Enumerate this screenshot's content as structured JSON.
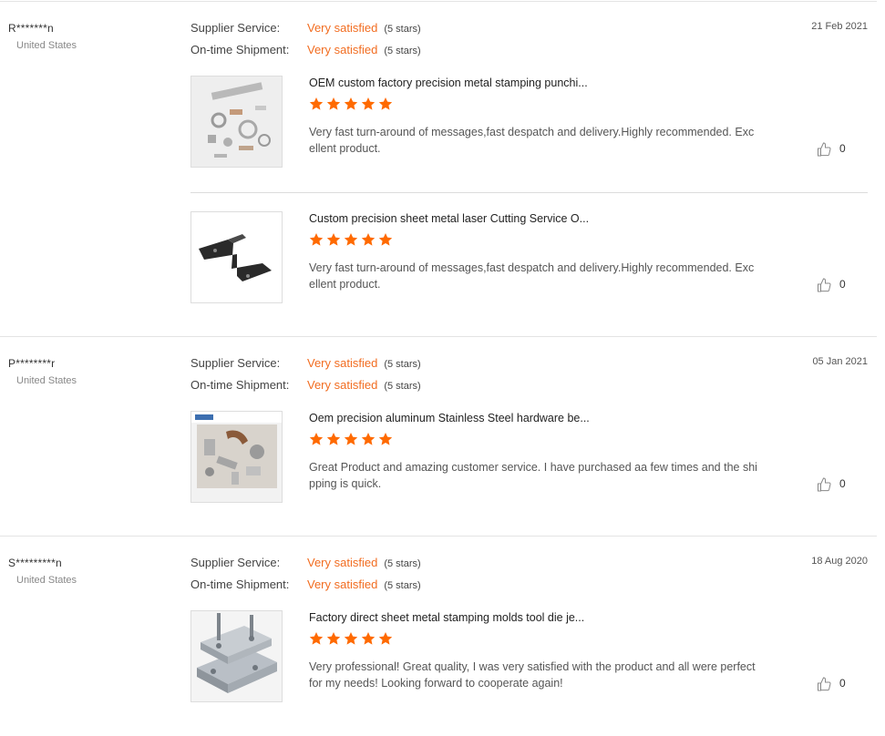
{
  "colors": {
    "accent": "#f26d21",
    "star": "#ff6a00",
    "divider": "#e4e4e4"
  },
  "reviews": [
    {
      "reviewer": "R*******n",
      "country": "United States",
      "date": "21 Feb 2021",
      "ratings": [
        {
          "label": "Supplier Service:",
          "value": "Very satisfied",
          "stars_text": "(5 stars)"
        },
        {
          "label": "On-time Shipment:",
          "value": "Very satisfied",
          "stars_text": "(5 stars)"
        }
      ],
      "products": [
        {
          "title": "OEM custom factory precision metal stamping punchi...",
          "rating": 5,
          "comment": "Very fast turn-around of messages,fast despatch and delivery.Highly recommended. Excellent product.",
          "likes": "0",
          "image_icon": "metal-parts-photo"
        },
        {
          "title": "Custom precision sheet metal laser Cutting Service O...",
          "rating": 5,
          "comment": "Very fast turn-around of messages,fast despatch and delivery.Highly recommended. Excellent product.",
          "likes": "0",
          "image_icon": "bracket-photo"
        }
      ]
    },
    {
      "reviewer": "P********r",
      "country": "United States",
      "date": "05 Jan 2021",
      "ratings": [
        {
          "label": "Supplier Service:",
          "value": "Very satisfied",
          "stars_text": "(5 stars)"
        },
        {
          "label": "On-time Shipment:",
          "value": "Very satisfied",
          "stars_text": "(5 stars)"
        }
      ],
      "products": [
        {
          "title": "Oem precision aluminum Stainless Steel hardware be...",
          "rating": 5,
          "comment": "Great Product and amazing customer service. I have purchased aa few times and the shipping is quick.",
          "likes": "0",
          "image_icon": "hardware-photo"
        }
      ]
    },
    {
      "reviewer": "S*********n",
      "country": "United States",
      "date": "18 Aug 2020",
      "ratings": [
        {
          "label": "Supplier Service:",
          "value": "Very satisfied",
          "stars_text": "(5 stars)"
        },
        {
          "label": "On-time Shipment:",
          "value": "Very satisfied",
          "stars_text": "(5 stars)"
        }
      ],
      "products": [
        {
          "title": "Factory direct sheet metal stamping molds tool die je...",
          "rating": 5,
          "comment": "Very professional! Great quality, I was very satisfied with the product and all were perfect for my needs! Looking forward to cooperate again!",
          "likes": "0",
          "image_icon": "mold-die-photo"
        }
      ]
    }
  ]
}
